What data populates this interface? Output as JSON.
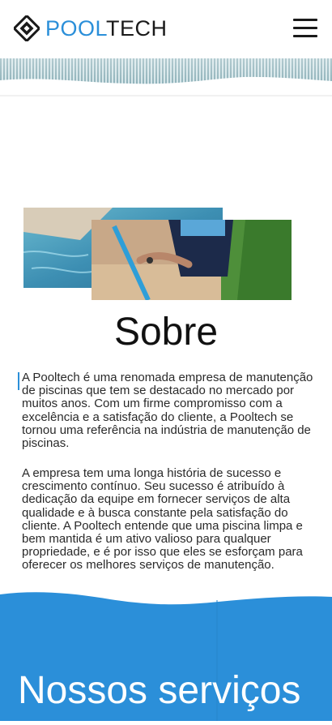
{
  "header": {
    "brand_pool": "POOL",
    "brand_tech": "TECH",
    "logo_icon": "diamond-logo-icon",
    "menu_icon": "hamburger-menu-icon"
  },
  "about": {
    "title": "Sobre",
    "paragraph1": "A Pooltech é uma renomada empresa de manutenção de piscinas que tem se destacado no mercado por muitos anos. Com um firme compromisso com a excelência e a satisfação do cliente, a Pooltech se tornou uma referência na indústria de manutenção de piscinas.",
    "paragraph2": "A empresa tem uma longa história de sucesso e crescimento contínuo. Seu sucesso é atribuído à dedicação da equipe em fornecer serviços de alta qualidade e à busca constante pela satisfação do cliente. A Pooltech entende que uma piscina limpa e bem mantida é um ativo valioso para qualquer propriedade, e é por isso que eles se esforçam para oferecer os melhores serviços de manutenção."
  },
  "services": {
    "title": "Nossos serviços"
  },
  "colors": {
    "brand_blue": "#2b8fd9",
    "services_bg": "#2b8fd9",
    "text": "#1e1e1e"
  }
}
